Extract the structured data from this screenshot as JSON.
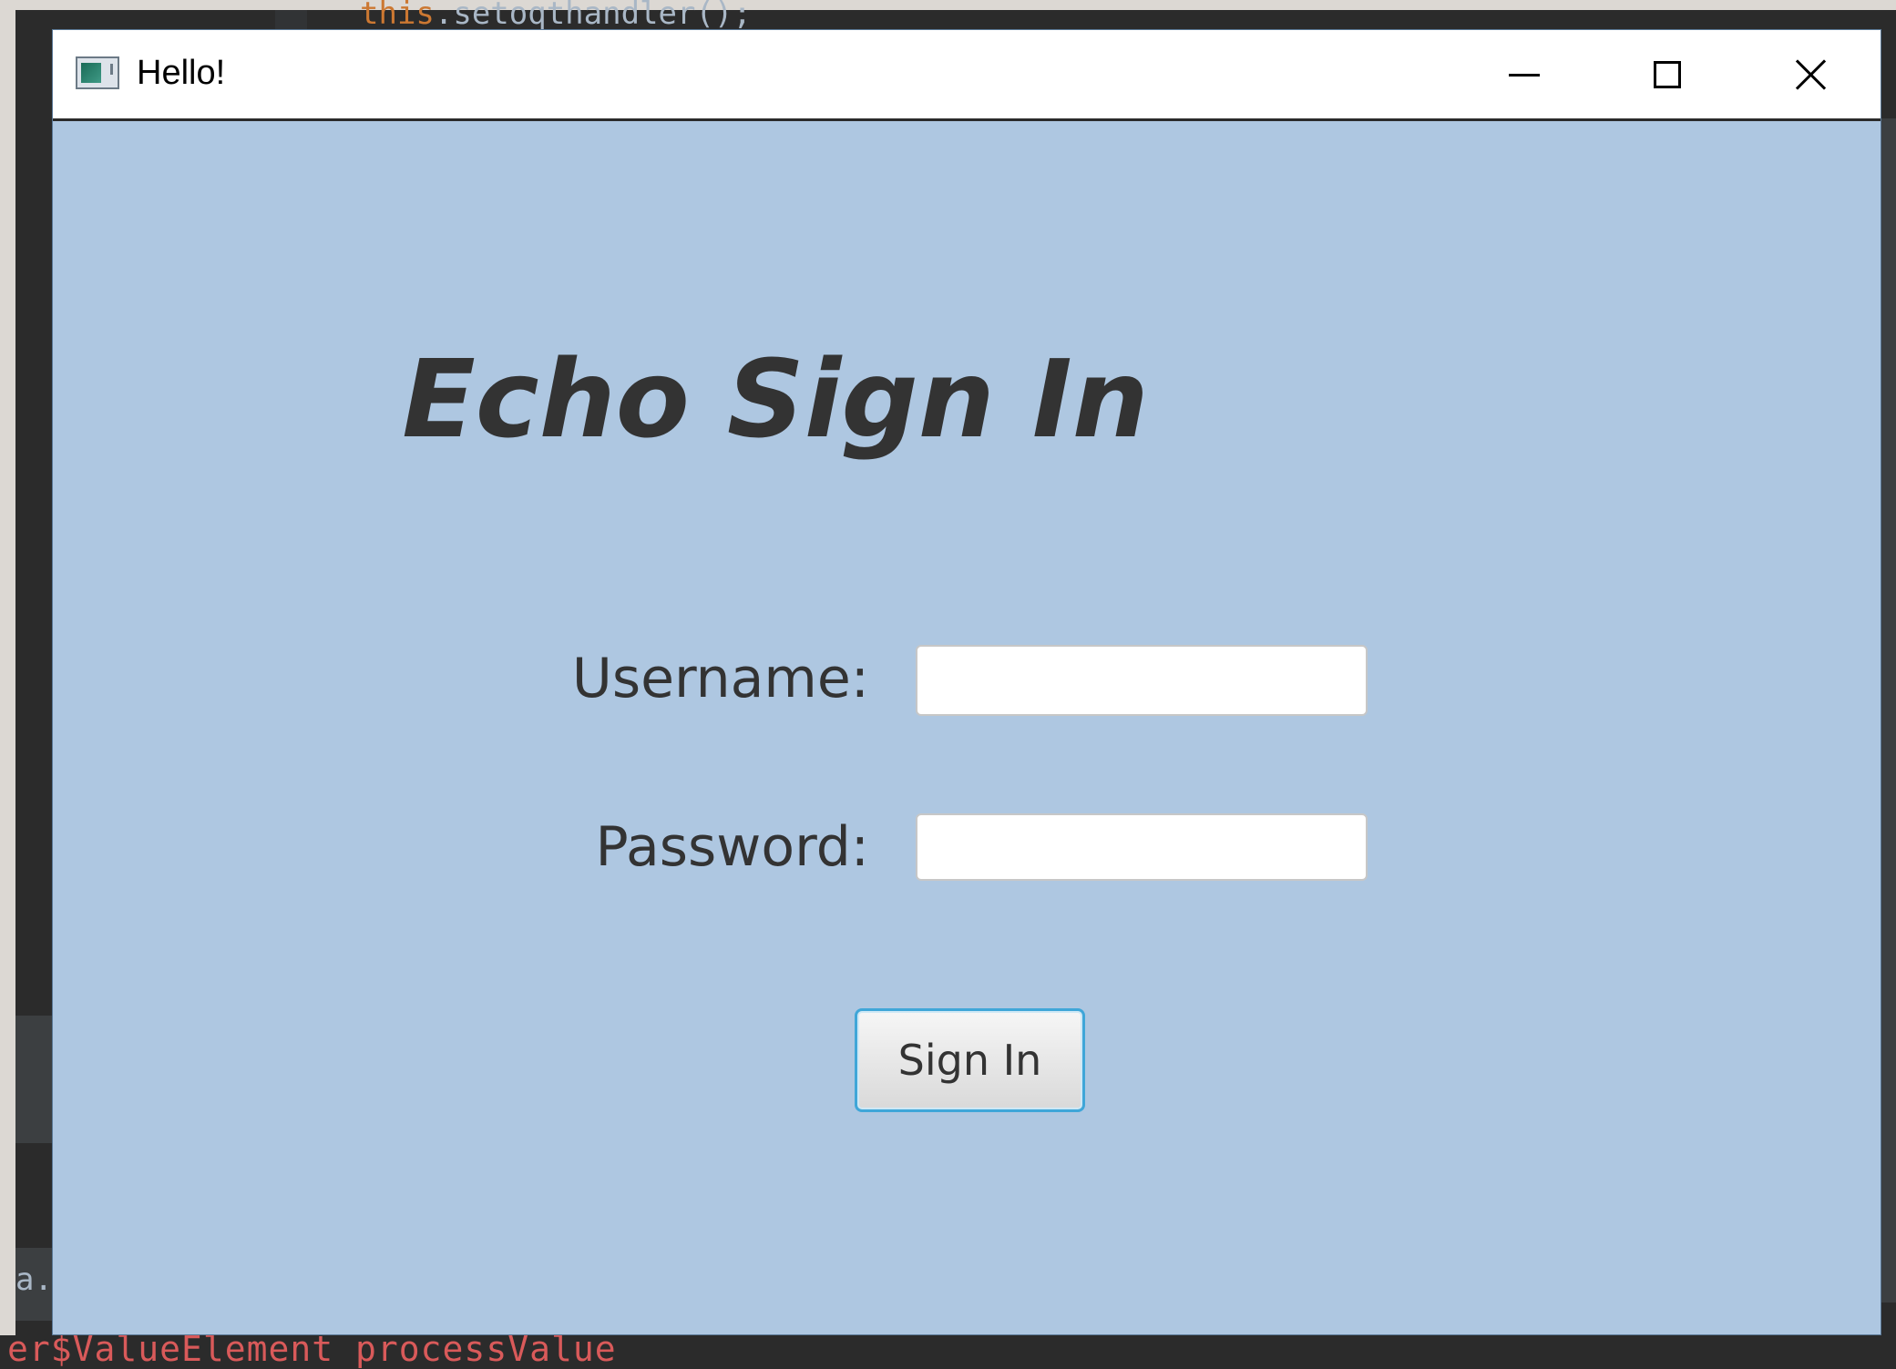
{
  "window": {
    "title": "Hello!"
  },
  "form": {
    "heading": "Echo Sign In",
    "username_label": "Username:",
    "username_value": "",
    "password_label": "Password:",
    "password_value": "",
    "sign_in_label": "Sign In"
  },
  "background": {
    "code_line_keyword": "this",
    "code_line_rest": ".setoqthandler();",
    "console_text": "er$ValueElement processValue",
    "left_char": "a."
  },
  "colors": {
    "window_background": "#aec7e1",
    "button_focus_border": "#3fa6d8",
    "console_error_text": "#d95a5a"
  },
  "icons": {
    "app": "java-app-icon",
    "minimize": "minimize-icon",
    "maximize": "maximize-icon",
    "close": "close-icon"
  }
}
